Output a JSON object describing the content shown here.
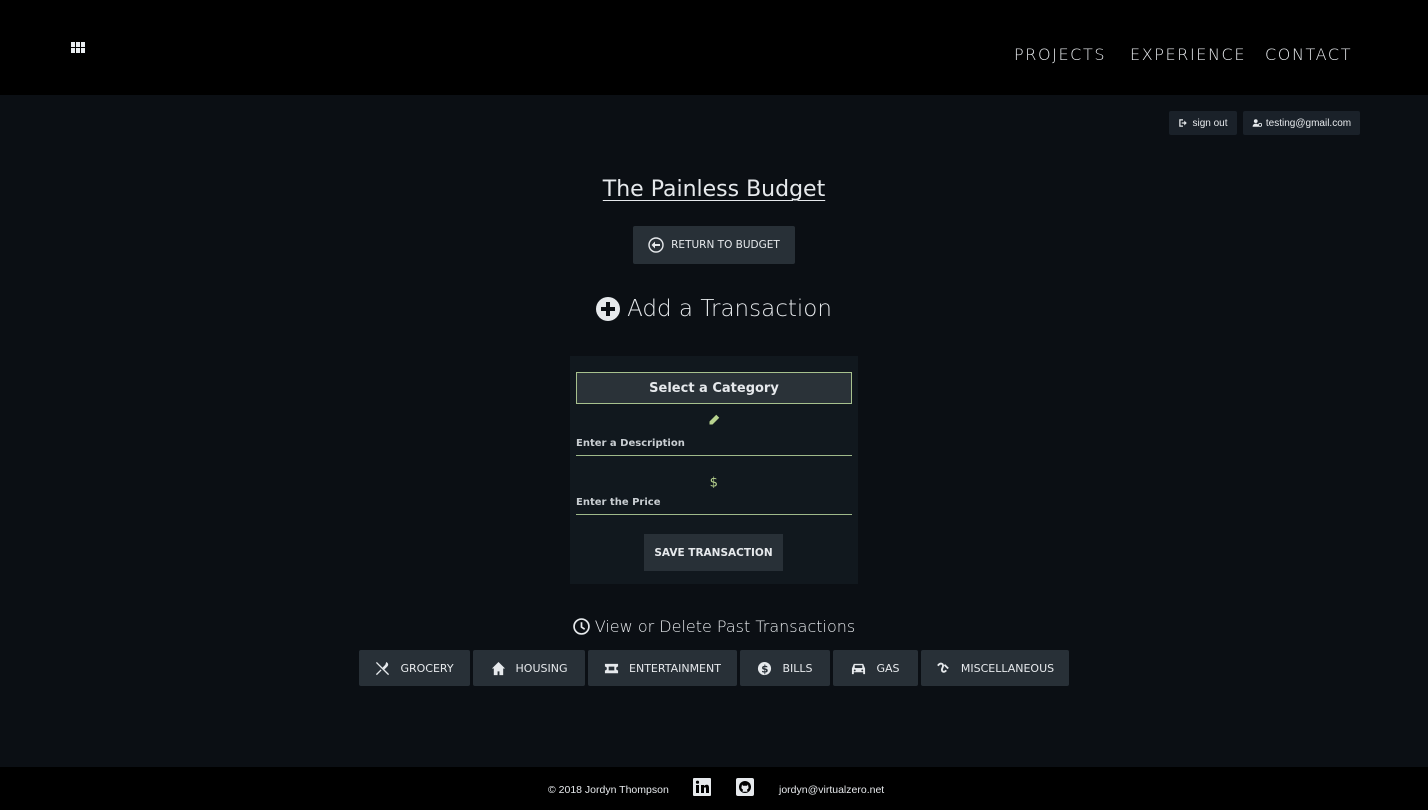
{
  "header": {
    "menu_icon": "grid-icon",
    "nav": [
      "PROJECTS",
      "EXPERIENCE",
      "CONTACT"
    ]
  },
  "account": {
    "sign_out": "sign out",
    "email": "testing@gmail.com"
  },
  "main": {
    "title": "The Painless Budget",
    "return_button": "RETURN TO BUDGET",
    "add_heading": "Add a Transaction",
    "form": {
      "category_label": "Select a Category",
      "description_placeholder": "Enter a Description",
      "price_placeholder": "Enter the Price",
      "save_button": "SAVE TRANSACTION"
    },
    "past_heading": "View or Delete Past Transactions",
    "categories": [
      {
        "label": "GROCERY",
        "icon": "utensils-icon"
      },
      {
        "label": "HOUSING",
        "icon": "home-icon"
      },
      {
        "label": "ENTERTAINMENT",
        "icon": "ticket-icon"
      },
      {
        "label": "BILLS",
        "icon": "dollar-circle-icon"
      },
      {
        "label": "GAS",
        "icon": "car-icon"
      },
      {
        "label": "MISCELLANEOUS",
        "icon": "misc-icon"
      }
    ]
  },
  "footer": {
    "copyright": "© 2018 Jordyn Thompson",
    "email": "jordyn@virtualzero.net",
    "icons": [
      "linkedin-icon",
      "github-icon"
    ]
  },
  "colors": {
    "background": "#0b0f14",
    "header": "#000000",
    "button": "#283037",
    "accent": "#a7c18e"
  }
}
